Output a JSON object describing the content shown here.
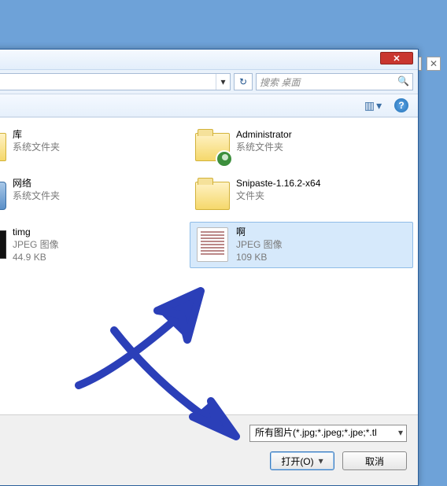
{
  "outer_window": {
    "maximize_glyph": "☐",
    "close_glyph": "✕"
  },
  "dialog": {
    "close_glyph": "✕",
    "path_dropdown_glyph": "▾",
    "refresh_glyph": "↻",
    "search_placeholder": "搜索 桌面",
    "search_icon_glyph": "🔍",
    "toolbar": {
      "views_glyph": "▥",
      "views_caret": "▾",
      "help_glyph": "?"
    }
  },
  "files_left": [
    {
      "name": "库",
      "sub1": "系统文件夹",
      "sub2": ""
    },
    {
      "name": "网络",
      "sub1": "系统文件夹",
      "sub2": ""
    },
    {
      "name": "timg",
      "sub1": "JPEG 图像",
      "sub2": "44.9 KB"
    }
  ],
  "files_right": [
    {
      "name": "Administrator",
      "sub1": "系统文件夹",
      "sub2": ""
    },
    {
      "name": "Snipaste-1.16.2-x64",
      "sub1": "文件夹",
      "sub2": ""
    },
    {
      "name": "啊",
      "sub1": "JPEG 图像",
      "sub2": "109 KB"
    }
  ],
  "selected_index_right": 2,
  "filter": {
    "text": "所有图片(*.jpg;*.jpeg;*.jpe;*.tl"
  },
  "buttons": {
    "open": "打开(O)",
    "open_caret": "▾",
    "cancel": "取消"
  }
}
